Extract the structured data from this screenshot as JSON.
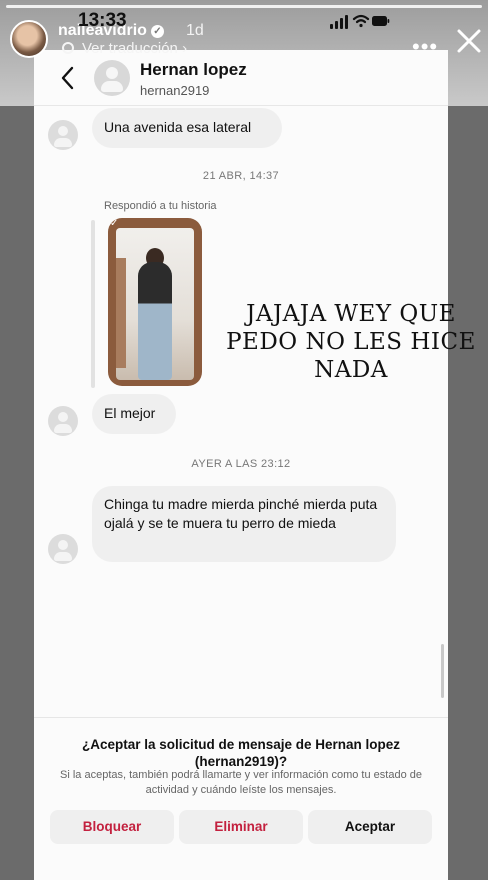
{
  "status_bar": {
    "time": "13:33"
  },
  "story": {
    "username": "naileavidrio",
    "age": "1d",
    "translate_label": "Ver traducción",
    "more_icon": "more-dots-icon",
    "close_icon": "close-icon"
  },
  "chat_header": {
    "name": "Hernan lopez",
    "handle": "hernan2919"
  },
  "messages": [
    {
      "text": "Una avenida esa lateral"
    },
    {
      "timestamp": "21 ABR, 14:37"
    },
    {
      "replied_label": "Respondió a tu historia"
    },
    {
      "text": "El mejor"
    },
    {
      "timestamp": "AYER A LAS 23:12"
    },
    {
      "text": "Chinga tu madre mierda pinché mierda puta ojalá y se te muera tu perro de mieda"
    }
  ],
  "overlay_text": "JAJAJA WEY QUE PEDO NO LES HICE NADA",
  "request": {
    "title": "¿Aceptar la solicitud de mensaje de Hernan lopez (hernan2919)?",
    "subtitle": "Si la aceptas, también podrá llamarte y ver información como tu estado de actividad y cuándo leíste los mensajes.",
    "block_label": "Bloquear",
    "delete_label": "Eliminar",
    "accept_label": "Aceptar"
  },
  "colors": {
    "danger": "#c3213f",
    "bubble": "#efefef",
    "background": "#fbfbfb"
  }
}
